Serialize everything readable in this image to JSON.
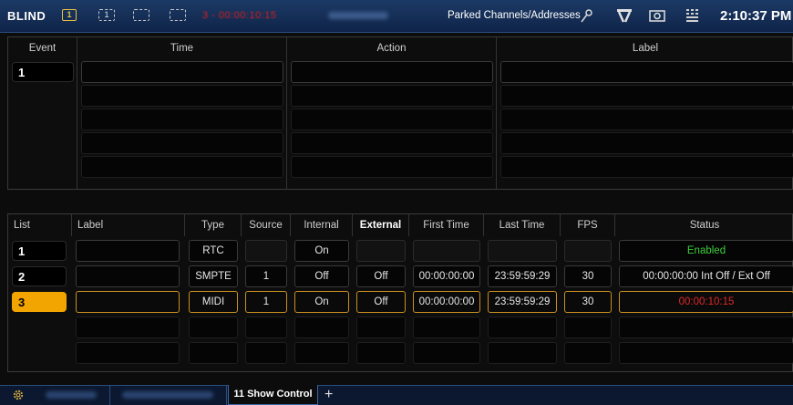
{
  "topbar": {
    "mode": "BLIND",
    "monitor1": "1",
    "monitor2": "1",
    "timecode": "3 - 00:00:10:15",
    "parked": "Parked Channels/Addresses",
    "clock": "2:10:37 PM",
    "icons": [
      "monitor-icon",
      "monitor-icon",
      "monitor-outline-icon",
      "monitor-outline-icon",
      "pin-icon",
      "network-icon",
      "camera-icon",
      "grid-icon"
    ]
  },
  "events": {
    "headers": {
      "event": "Event",
      "time": "Time",
      "action": "Action",
      "label": "Label"
    },
    "rows": [
      {
        "num": "1",
        "time": "",
        "action": "",
        "label": ""
      }
    ]
  },
  "lists": {
    "headers": {
      "list": "List",
      "label": "Label",
      "type": "Type",
      "source": "Source",
      "internal": "Internal",
      "external": "External",
      "first": "First Time",
      "last": "Last Time",
      "fps": "FPS",
      "status": "Status"
    },
    "rows": [
      {
        "num": "1",
        "label": "",
        "type": "RTC",
        "source": "",
        "internal": "On",
        "external": "",
        "first": "",
        "last": "",
        "fps": "",
        "status": "Enabled"
      },
      {
        "num": "2",
        "label": "",
        "type": "SMPTE",
        "source": "1",
        "internal": "Off",
        "external": "Off",
        "first": "00:00:00:00",
        "last": "23:59:59:29",
        "fps": "30",
        "status": "00:00:00:00  Int Off / Ext Off"
      },
      {
        "num": "3",
        "label": "",
        "type": "MIDI",
        "source": "1",
        "internal": "On",
        "external": "Off",
        "first": "00:00:00:00",
        "last": "23:59:59:29",
        "fps": "30",
        "status": "00:00:10:15"
      }
    ]
  },
  "tabs": {
    "active": "11 Show Control",
    "plus": "+"
  },
  "colors": {
    "accent": "#f2a400",
    "topbar": "#1c3a66",
    "enabled": "#3ccf3c",
    "timecode": "#e02828"
  }
}
